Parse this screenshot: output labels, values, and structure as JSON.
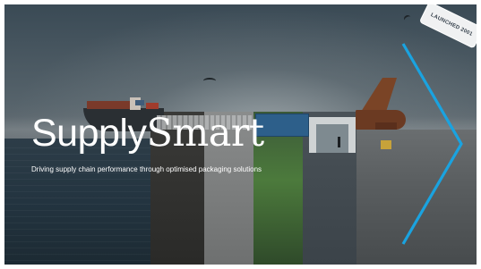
{
  "slide": {
    "title_part1": "Supply",
    "title_part2": "Smart",
    "subtitle": "Driving supply chain performance through optimised packaging solutions",
    "badge": "LAUNCHED 2001"
  },
  "colors": {
    "accent_chevron": "#1aa3e0",
    "title_text": "#ffffff"
  }
}
